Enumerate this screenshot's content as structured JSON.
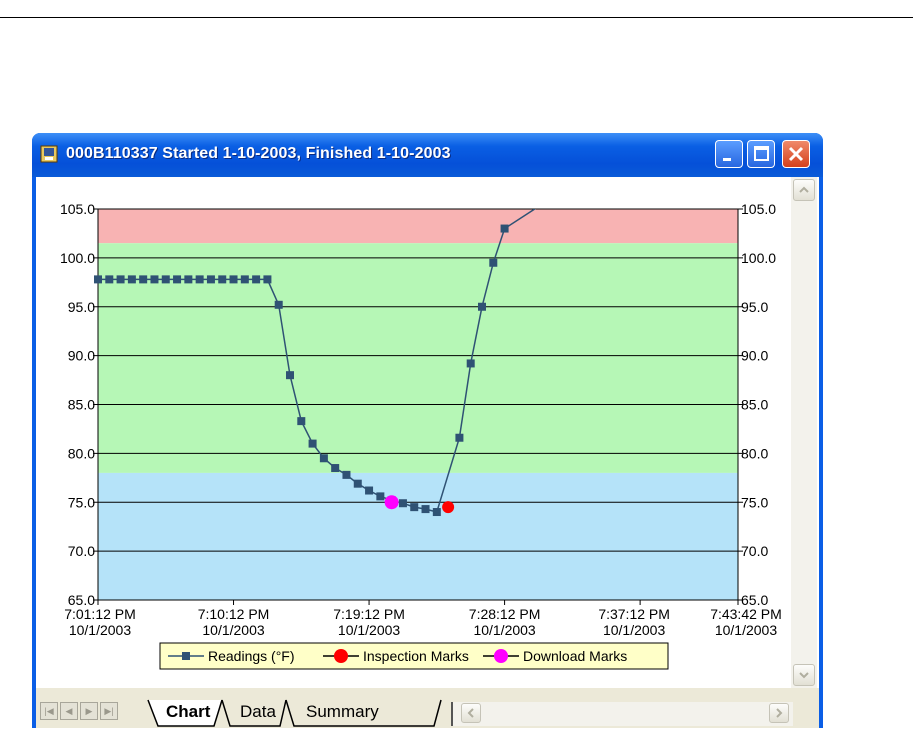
{
  "window": {
    "title": "000B110337 Started 1-10-2003, Finished 1-10-2003",
    "minimize_label": "_",
    "maximize_label": "□",
    "close_label": "✕"
  },
  "tabs": [
    {
      "label": "Chart",
      "active": true
    },
    {
      "label": "Data",
      "active": false
    },
    {
      "label": "Summary",
      "active": false
    }
  ],
  "nav_buttons": [
    "|◀",
    "◀",
    "▶",
    "▶|"
  ],
  "colors": {
    "alarm_high_band": "#f8b3b3",
    "normal_band": "#b6f7b6",
    "alarm_low_band": "#b5e3f9",
    "readings_series": "#2f5274",
    "inspection_mark": "#ff0000",
    "download_mark": "#ff00ff"
  },
  "chart_data": {
    "type": "line",
    "y_ticks": [
      "105.0",
      "100.0",
      "95.0",
      "90.0",
      "85.0",
      "80.0",
      "75.0",
      "70.0",
      "65.0"
    ],
    "ylim": [
      65,
      105
    ],
    "x_ticks": [
      {
        "minute": 0,
        "time": "7:01:12 PM",
        "date": "10/1/2003"
      },
      {
        "minute": 9,
        "time": "7:10:12 PM",
        "date": "10/1/2003"
      },
      {
        "minute": 18,
        "time": "7:19:12 PM",
        "date": "10/1/2003"
      },
      {
        "minute": 27,
        "time": "7:28:12 PM",
        "date": "10/1/2003"
      },
      {
        "minute": 36,
        "time": "7:37:12 PM",
        "date": "10/1/2003"
      },
      {
        "minute": 42.5,
        "time": "7:43:42 PM",
        "date": "10/1/2003"
      }
    ],
    "xlim_minutes": [
      0,
      42.5
    ],
    "bands": [
      {
        "from": 101.5,
        "to": 105,
        "color": "#f8b3b3"
      },
      {
        "from": 78,
        "to": 101.5,
        "color": "#b6f7b6"
      },
      {
        "from": 65,
        "to": 78,
        "color": "#b5e3f9"
      }
    ],
    "series": [
      {
        "name": "Readings (°F)",
        "points": [
          [
            0,
            97.8
          ],
          [
            0.75,
            97.8
          ],
          [
            1.5,
            97.8
          ],
          [
            2.25,
            97.8
          ],
          [
            3,
            97.8
          ],
          [
            3.75,
            97.8
          ],
          [
            4.5,
            97.8
          ],
          [
            5.25,
            97.8
          ],
          [
            6,
            97.8
          ],
          [
            6.75,
            97.8
          ],
          [
            7.5,
            97.8
          ],
          [
            8.25,
            97.8
          ],
          [
            9,
            97.8
          ],
          [
            9.75,
            97.8
          ],
          [
            10.5,
            97.8
          ],
          [
            11.25,
            97.8
          ],
          [
            12,
            95.2
          ],
          [
            12.75,
            88
          ],
          [
            13.5,
            83.3
          ],
          [
            14.25,
            81
          ],
          [
            15,
            79.5
          ],
          [
            15.75,
            78.5
          ],
          [
            16.5,
            77.8
          ],
          [
            17.25,
            76.9
          ],
          [
            18,
            76.2
          ],
          [
            18.75,
            75.6
          ],
          [
            19.5,
            75.2
          ],
          [
            20.25,
            74.9
          ],
          [
            21,
            74.5
          ],
          [
            21.75,
            74.3
          ],
          [
            22.5,
            74
          ],
          [
            24,
            81.6
          ],
          [
            24.75,
            89.2
          ],
          [
            25.5,
            95
          ],
          [
            26.25,
            99.5
          ],
          [
            27,
            103
          ]
        ],
        "curve_end": [
          30,
          106
        ]
      },
      {
        "name": "Inspection Marks",
        "points": [
          [
            23.25,
            74.5
          ]
        ]
      },
      {
        "name": "Download Marks",
        "points": [
          [
            19.5,
            75
          ]
        ]
      }
    ],
    "grid": true,
    "legend_position": "bottom-center"
  }
}
